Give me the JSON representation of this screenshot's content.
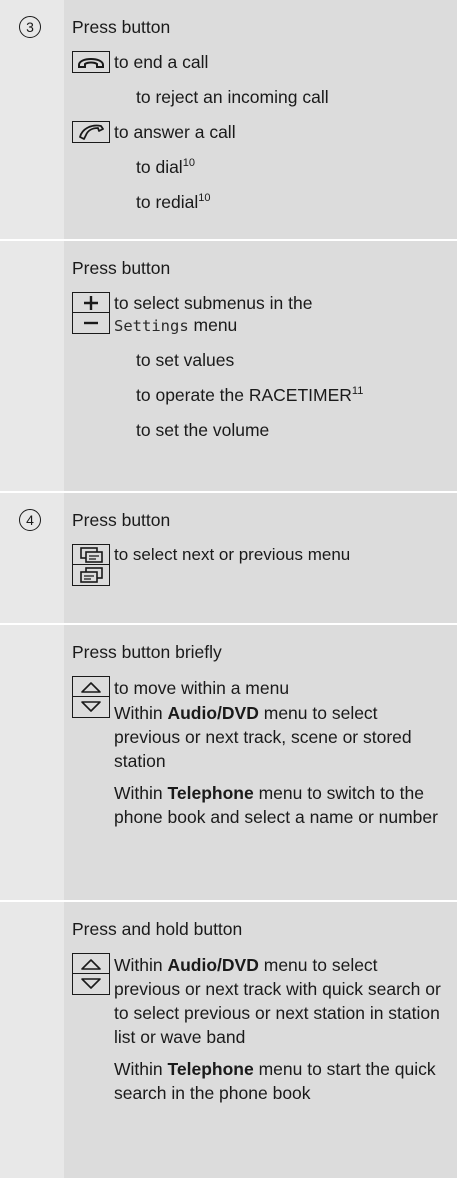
{
  "rows": [
    {
      "number": "3",
      "head": "Press button",
      "end_call": "to end a call",
      "reject": "to reject an incoming call",
      "answer": "to answer a call",
      "dial": "to dial",
      "dial_sup": "10",
      "redial": "to redial",
      "redial_sup": "10"
    },
    {
      "head": "Press button",
      "select_submenus": "to select submenus in the",
      "settings_word": "Settings",
      "menu_word": " menu",
      "set_values": "to set values",
      "racetimer": "to operate the RACETIMER",
      "racetimer_sup": "11",
      "volume": "to set the volume"
    },
    {
      "number": "4",
      "head": "Press button",
      "select_menu": "to select next or previous menu"
    },
    {
      "head": "Press button briefly",
      "move": "to move within a menu",
      "within": "Within ",
      "audio": "Audio/DVD",
      "audio_tail": " menu to select previous or next track, scene or stored station",
      "telephone": "Telephone",
      "telephone_tail": " menu to switch to the phone book and select a name or number"
    },
    {
      "head": "Press and hold button",
      "within": "Within ",
      "audio": "Audio/DVD",
      "audio_tail": " menu to select previous or next track with quick search or to select previous or next station in station list or wave band",
      "telephone": "Telephone",
      "telephone_tail": " menu to start the quick search in the phone book"
    }
  ],
  "icons": {
    "end_call": "phone-hangup-icon",
    "answer": "phone-answer-icon",
    "plus": "plus-icon",
    "minus": "minus-icon",
    "menu_next": "menu-next-icon",
    "menu_prev": "menu-previous-icon",
    "up": "arrow-up-icon",
    "down": "arrow-down-icon"
  }
}
